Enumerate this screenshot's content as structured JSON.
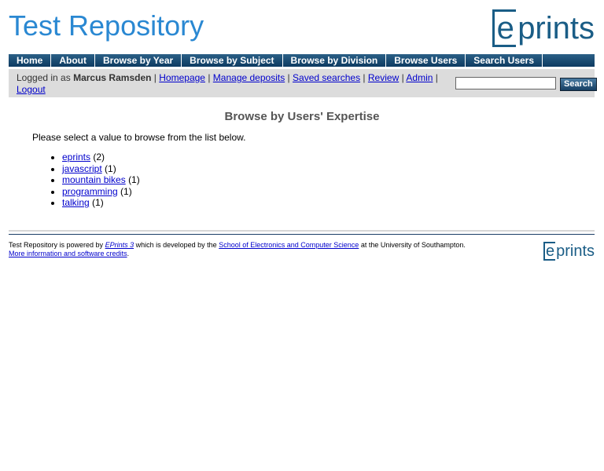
{
  "header": {
    "site_title": "Test Repository",
    "logo_e": "e",
    "logo_text": "prints"
  },
  "menu": {
    "items": [
      "Home",
      "About",
      "Browse by Year",
      "Browse by Subject",
      "Browse by Division",
      "Browse Users",
      "Search Users"
    ]
  },
  "login": {
    "prefix": "Logged in as",
    "user_name": "Marcus Ramsden",
    "links": [
      "Homepage",
      "Manage deposits",
      "Saved searches",
      "Review",
      "Admin"
    ],
    "logout": "Logout",
    "separator": "|",
    "search_value": "",
    "search_button": "Search"
  },
  "main": {
    "heading": "Browse by Users' Expertise",
    "intro": "Please select a value to browse from the list below.",
    "items": [
      {
        "label": "eprints",
        "count": "(2)"
      },
      {
        "label": "javascript",
        "count": "(1)"
      },
      {
        "label": "mountain bikes",
        "count": "(1)"
      },
      {
        "label": "programming",
        "count": "(1)"
      },
      {
        "label": "talking",
        "count": "(1)"
      }
    ]
  },
  "footer": {
    "text1": "Test Repository is powered by",
    "link1": "EPrints 3",
    "text2": "which is developed by the",
    "link2": "School of Electronics and Computer Science",
    "text3": "at the University of Southampton.",
    "link3": "More information and software credits",
    "text4": ".",
    "logo_e": "e",
    "logo_text": "prints"
  },
  "colors": {
    "title_blue": "#2a88d2",
    "menu_bg": "#0d3b61",
    "link": "#0000cc",
    "login_bg": "#dcdcdc"
  }
}
